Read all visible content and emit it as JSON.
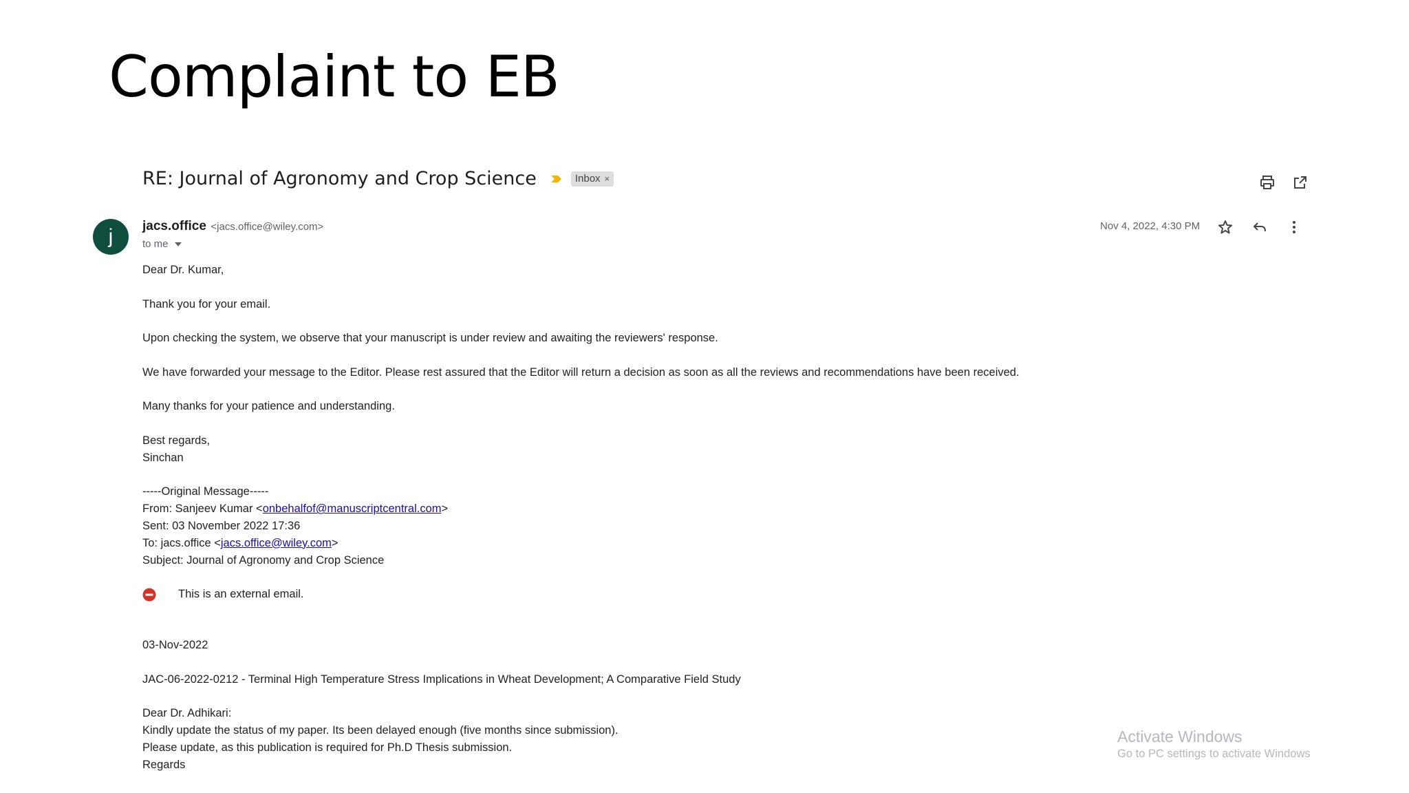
{
  "slide": {
    "title": "Complaint to EB"
  },
  "email": {
    "subject": "RE: Journal of Agronomy and Crop Science",
    "label": "Inbox",
    "label_remove": "×",
    "sender_name": "jacs.office",
    "sender_email": "<jacs.office@wiley.com>",
    "recipient": "to me",
    "date": "Nov 4, 2022, 4:30 PM",
    "icons": {
      "importance": "importance-marker-icon",
      "print": "print-icon",
      "new_window": "open-in-new-window-icon",
      "star": "star-icon",
      "reply": "reply-icon",
      "more": "more-vert-icon",
      "external_warning": "no-entry-icon"
    },
    "avatar_letter": "j",
    "avatar_color": "#0f4e3e",
    "body": {
      "greeting": "Dear Dr. Kumar,",
      "line1": "Thank you for your email.",
      "line2": "Upon checking the system, we observe that your manuscript is under review and awaiting the reviewers' response.",
      "line3": "We have forwarded your message to the Editor. Please rest assured that the Editor will return a decision as soon as all the reviews and recommendations have been received.",
      "line4": "Many thanks for your patience and understanding.",
      "closing": "Best regards,",
      "signature": "Sinchan"
    },
    "original": {
      "header": "-----Original Message-----",
      "from_prefix": "From: Sanjeev Kumar <",
      "from_link": "onbehalfof@manuscriptcentral.com",
      "from_suffix": ">",
      "sent": "Sent: 03 November 2022 17:36",
      "to_prefix": "To: jacs.office <",
      "to_link": "jacs.office@wiley.com",
      "to_suffix": ">",
      "subject": "Subject: Journal of Agronomy and Crop Science",
      "external_notice": "This is an external email.",
      "date": "03-Nov-2022",
      "manuscript": "JAC-06-2022-0212 - Terminal High Temperature Stress Implications in Wheat Development; A Comparative Field Study",
      "salutation": "Dear Dr. Adhikari:",
      "request1": "Kindly update the status of my paper. Its been delayed enough (five months since submission).",
      "request2": "Please update, as this publication is required for Ph.D Thesis submission.",
      "regards": "Regards"
    }
  },
  "watermark": {
    "title": "Activate Windows",
    "subtitle": "Go to PC settings to activate Windows"
  },
  "colors": {
    "accent_link": "#1a0dab",
    "importance": "#f4b400",
    "warning": "#d93025"
  }
}
